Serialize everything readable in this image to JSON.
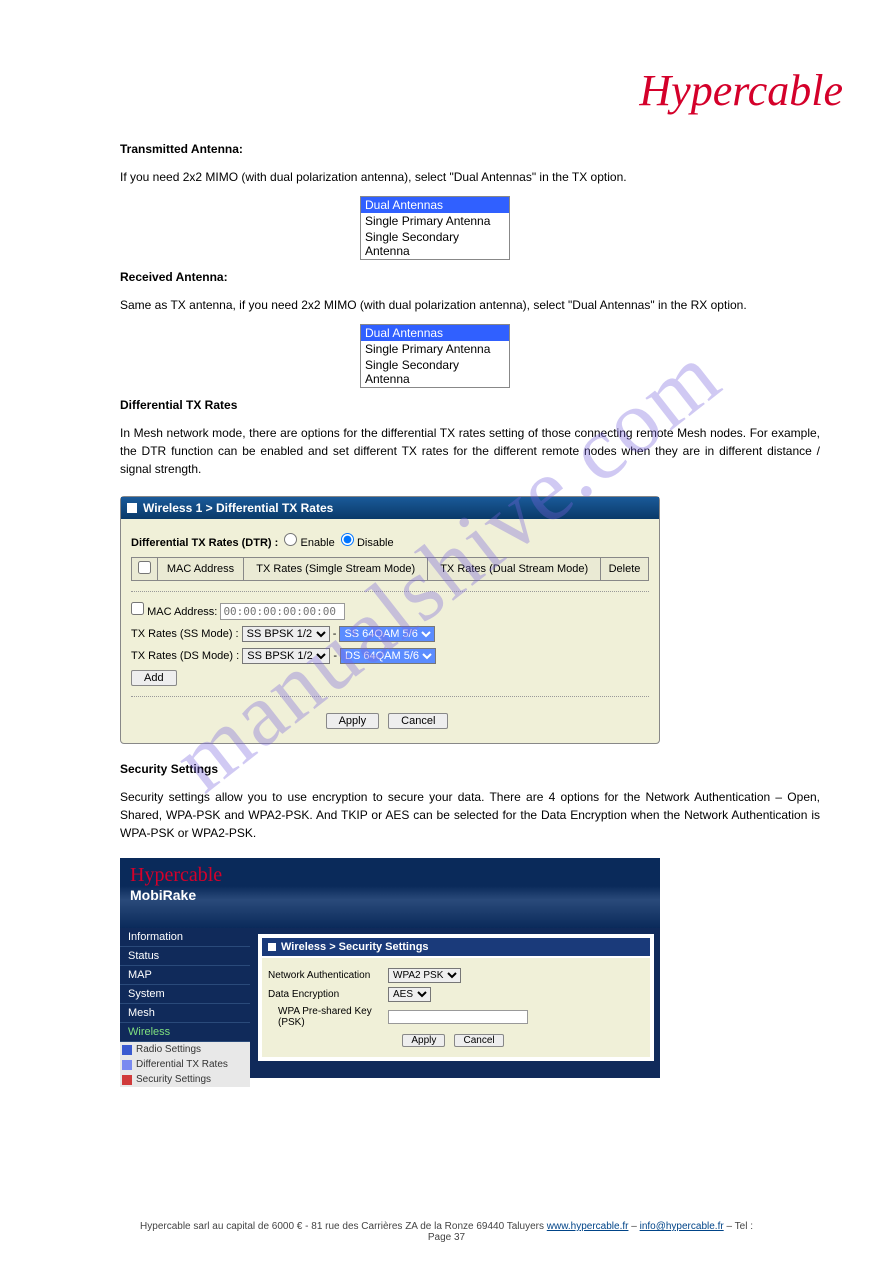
{
  "brand": "Hypercable",
  "watermark": "manualshive.com",
  "sections": {
    "intro_text": "If you need 2x2 MIMO (with dual polarization antenna), select \"Dual Antennas\" in the TX option.",
    "tx_antenna_label": "Transmitted Antenna:",
    "rx_antenna_label": "Received Antenna:",
    "rcv_text": "Same as TX antenna, if you need 2x2 MIMO (with dual polarization antenna), select \"Dual Antennas\" in the RX option.",
    "dd_options": [
      "Dual Antennas",
      "Single Primary Antenna",
      "Single Secondary Antenna"
    ],
    "dtr_label": "Differential TX Rates",
    "dtr_text": "In Mesh network mode, there are options for the differential TX rates setting of those connecting remote Mesh nodes. For example, the DTR function can be enabled and set different TX rates for the different remote nodes when they are in different distance / signal strength.",
    "dtr_panel": {
      "title": "Wireless 1 > Differential TX Rates",
      "dtr_switch": "Differential TX Rates (DTR) :",
      "enable": "Enable",
      "disable": "Disable",
      "cols": [
        "MAC Address",
        "TX Rates (Simgle Stream Mode)",
        "TX Rates (Dual Stream Mode)"
      ],
      "delete": "Delete",
      "mac_label": "MAC Address:",
      "mac_placeholder": "00:00:00:00:00:00",
      "ss_label": "TX Rates (SS Mode) :",
      "ds_label": "TX Rates (DS Mode) :",
      "ss_opts": [
        "SS BPSK 1/2",
        "SS 64QAM 5/6"
      ],
      "ds_opts": [
        "SS BPSK 1/2",
        "DS 64QAM 5/6"
      ],
      "add": "Add",
      "apply": "Apply",
      "cancel": "Cancel"
    },
    "sec_intro_label": "Security Settings",
    "sec_intro_text": "Security settings allow you to use encryption to secure your data. There are 4 options for the Network Authentication – Open, Shared, WPA-PSK and WPA2-PSK. And TKIP or AES can be selected for the Data Encryption when the Network Authentication is WPA-PSK or WPA2-PSK.",
    "sec_panel": {
      "logo1": "Hypercable",
      "logo2": "MobiRake",
      "nav": [
        "Information",
        "Status",
        "MAP",
        "System",
        "Mesh",
        "Wireless"
      ],
      "subs": [
        "Radio Settings",
        "Differential TX Rates",
        "Security Settings"
      ],
      "title": "Wireless > Security Settings",
      "rows": {
        "na_label": "Network Authentication",
        "na_val": "WPA2 PSK",
        "de_label": "Data Encryption",
        "de_val": "AES",
        "psk_label": "WPA Pre-shared Key (PSK)"
      },
      "apply": "Apply",
      "cancel": "Cancel"
    }
  },
  "footer": {
    "line1": "Hypercable",
    "addr": "sarl au capital de 6000 €  - 81 rue des Carrières ZA de la Ronze 69440 Taluyers",
    "site": "www.hypercable.fr",
    "email": "info@hypercable.fr",
    "tel": "– Tel :",
    "page": "Page 37"
  }
}
